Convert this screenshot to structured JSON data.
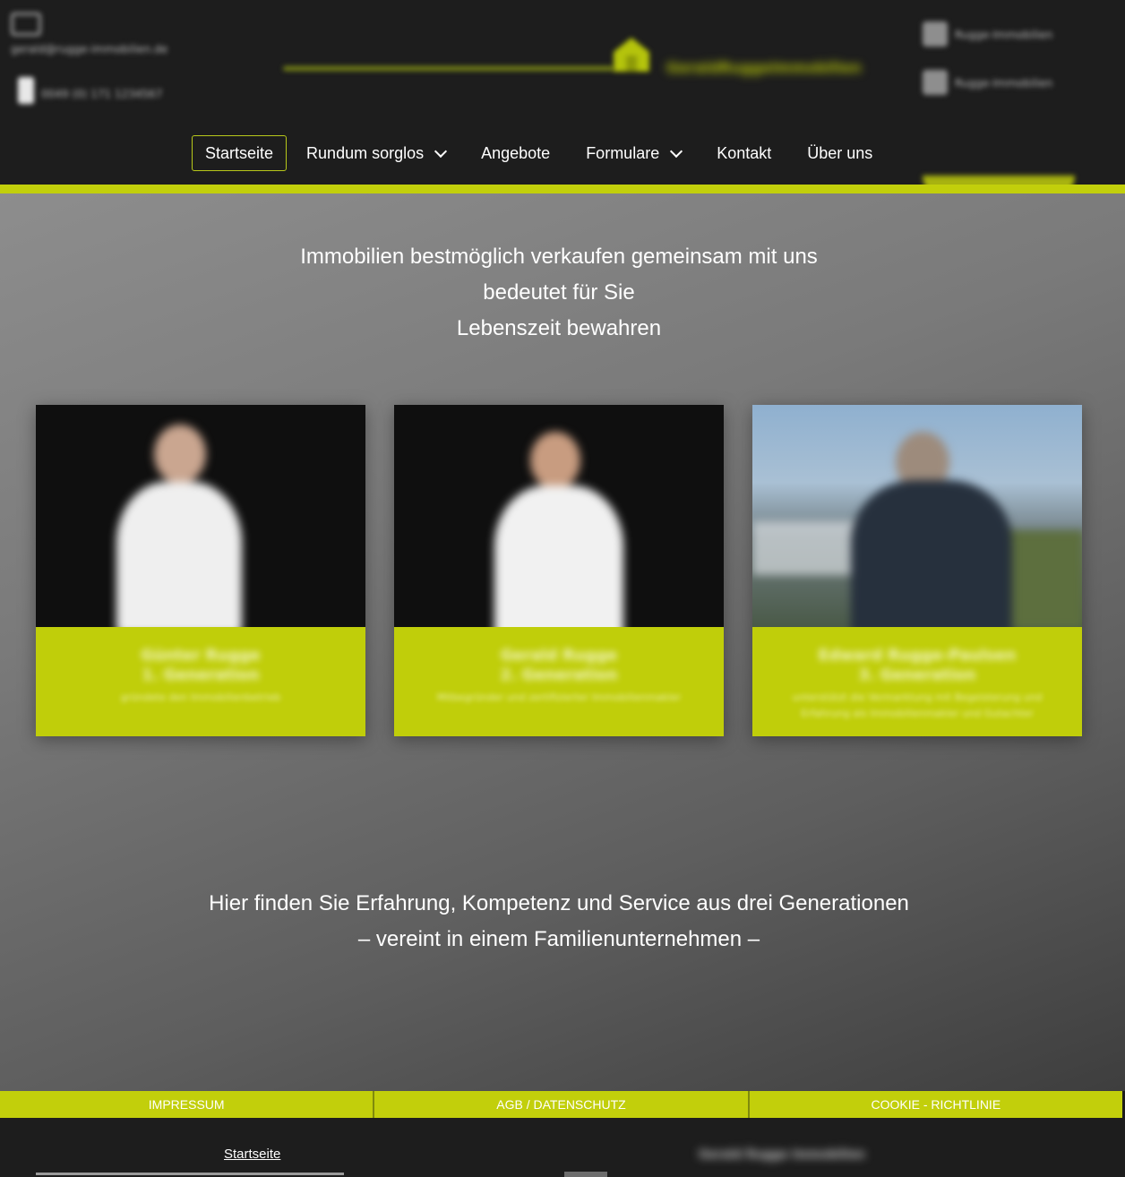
{
  "header": {
    "email": "gerald@rugge-immobilien.de",
    "phone": "0049 (0) 171 1234567",
    "logo_text": "GeraldRuggeImmobilien",
    "social": [
      {
        "icon": "facebook-icon",
        "label": "Rugge-Immobilien"
      },
      {
        "icon": "instagram-icon",
        "label": "Rugge-Immobilien"
      }
    ]
  },
  "nav": {
    "items": [
      "Startseite",
      "Rundum sorglos",
      "Angebote",
      "Formulare",
      "Kontakt",
      "Über uns"
    ]
  },
  "hero": {
    "headline_lines": [
      "Immobilien bestmöglich verkaufen gemeinsam mit uns",
      "bedeutet für Sie",
      "Lebenszeit bewahren"
    ],
    "sub_lines": [
      "Hier finden Sie Erfahrung, Kompetenz und Service aus drei Generationen",
      "– vereint in einem Familienunternehmen –"
    ]
  },
  "team": [
    {
      "name": "Günter Rugge",
      "generation": "1. Generation",
      "role": "gründete den Immobilienbetrieb"
    },
    {
      "name": "Gerald Rugge",
      "generation": "2. Generation",
      "role": "Mitbegründer und zertifizierter Immobilienmakler"
    },
    {
      "name": "Edward Rugge-Paulsen",
      "generation": "3. Generation",
      "role": "unterstützt die Vermarktung mit Begeisterung und Erfahrung als Immobilienmakler und Gutachter"
    }
  ],
  "footer": {
    "links": [
      "IMPRESSUM",
      "AGB / DATENSCHUTZ",
      "COOKIE - RICHTLINIE"
    ],
    "bottom_link": "Startseite",
    "brand": "Gerald Rugge Immobilien"
  },
  "colors": {
    "accent": "#c2cf0b",
    "dark": "#1d1d1d"
  }
}
